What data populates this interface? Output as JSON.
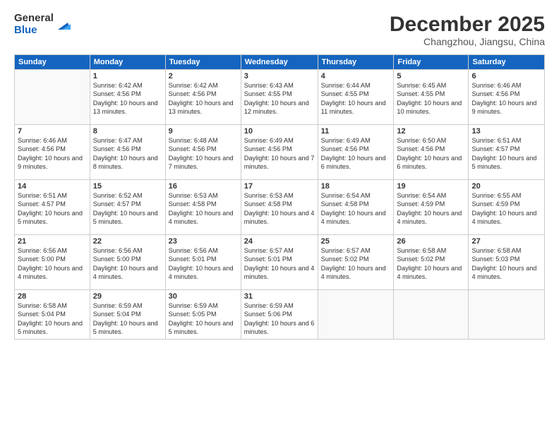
{
  "logo": {
    "general": "General",
    "blue": "Blue"
  },
  "title": "December 2025",
  "location": "Changzhou, Jiangsu, China",
  "weekdays": [
    "Sunday",
    "Monday",
    "Tuesday",
    "Wednesday",
    "Thursday",
    "Friday",
    "Saturday"
  ],
  "weeks": [
    [
      {
        "day": "",
        "info": ""
      },
      {
        "day": "1",
        "info": "Sunrise: 6:42 AM\nSunset: 4:56 PM\nDaylight: 10 hours\nand 13 minutes."
      },
      {
        "day": "2",
        "info": "Sunrise: 6:42 AM\nSunset: 4:56 PM\nDaylight: 10 hours\nand 13 minutes."
      },
      {
        "day": "3",
        "info": "Sunrise: 6:43 AM\nSunset: 4:55 PM\nDaylight: 10 hours\nand 12 minutes."
      },
      {
        "day": "4",
        "info": "Sunrise: 6:44 AM\nSunset: 4:55 PM\nDaylight: 10 hours\nand 11 minutes."
      },
      {
        "day": "5",
        "info": "Sunrise: 6:45 AM\nSunset: 4:55 PM\nDaylight: 10 hours\nand 10 minutes."
      },
      {
        "day": "6",
        "info": "Sunrise: 6:46 AM\nSunset: 4:56 PM\nDaylight: 10 hours\nand 9 minutes."
      }
    ],
    [
      {
        "day": "7",
        "info": "Sunrise: 6:46 AM\nSunset: 4:56 PM\nDaylight: 10 hours\nand 9 minutes."
      },
      {
        "day": "8",
        "info": "Sunrise: 6:47 AM\nSunset: 4:56 PM\nDaylight: 10 hours\nand 8 minutes."
      },
      {
        "day": "9",
        "info": "Sunrise: 6:48 AM\nSunset: 4:56 PM\nDaylight: 10 hours\nand 7 minutes."
      },
      {
        "day": "10",
        "info": "Sunrise: 6:49 AM\nSunset: 4:56 PM\nDaylight: 10 hours\nand 7 minutes."
      },
      {
        "day": "11",
        "info": "Sunrise: 6:49 AM\nSunset: 4:56 PM\nDaylight: 10 hours\nand 6 minutes."
      },
      {
        "day": "12",
        "info": "Sunrise: 6:50 AM\nSunset: 4:56 PM\nDaylight: 10 hours\nand 6 minutes."
      },
      {
        "day": "13",
        "info": "Sunrise: 6:51 AM\nSunset: 4:57 PM\nDaylight: 10 hours\nand 5 minutes."
      }
    ],
    [
      {
        "day": "14",
        "info": "Sunrise: 6:51 AM\nSunset: 4:57 PM\nDaylight: 10 hours\nand 5 minutes."
      },
      {
        "day": "15",
        "info": "Sunrise: 6:52 AM\nSunset: 4:57 PM\nDaylight: 10 hours\nand 5 minutes."
      },
      {
        "day": "16",
        "info": "Sunrise: 6:53 AM\nSunset: 4:58 PM\nDaylight: 10 hours\nand 4 minutes."
      },
      {
        "day": "17",
        "info": "Sunrise: 6:53 AM\nSunset: 4:58 PM\nDaylight: 10 hours\nand 4 minutes."
      },
      {
        "day": "18",
        "info": "Sunrise: 6:54 AM\nSunset: 4:58 PM\nDaylight: 10 hours\nand 4 minutes."
      },
      {
        "day": "19",
        "info": "Sunrise: 6:54 AM\nSunset: 4:59 PM\nDaylight: 10 hours\nand 4 minutes."
      },
      {
        "day": "20",
        "info": "Sunrise: 6:55 AM\nSunset: 4:59 PM\nDaylight: 10 hours\nand 4 minutes."
      }
    ],
    [
      {
        "day": "21",
        "info": "Sunrise: 6:56 AM\nSunset: 5:00 PM\nDaylight: 10 hours\nand 4 minutes."
      },
      {
        "day": "22",
        "info": "Sunrise: 6:56 AM\nSunset: 5:00 PM\nDaylight: 10 hours\nand 4 minutes."
      },
      {
        "day": "23",
        "info": "Sunrise: 6:56 AM\nSunset: 5:01 PM\nDaylight: 10 hours\nand 4 minutes."
      },
      {
        "day": "24",
        "info": "Sunrise: 6:57 AM\nSunset: 5:01 PM\nDaylight: 10 hours\nand 4 minutes."
      },
      {
        "day": "25",
        "info": "Sunrise: 6:57 AM\nSunset: 5:02 PM\nDaylight: 10 hours\nand 4 minutes."
      },
      {
        "day": "26",
        "info": "Sunrise: 6:58 AM\nSunset: 5:02 PM\nDaylight: 10 hours\nand 4 minutes."
      },
      {
        "day": "27",
        "info": "Sunrise: 6:58 AM\nSunset: 5:03 PM\nDaylight: 10 hours\nand 4 minutes."
      }
    ],
    [
      {
        "day": "28",
        "info": "Sunrise: 6:58 AM\nSunset: 5:04 PM\nDaylight: 10 hours\nand 5 minutes."
      },
      {
        "day": "29",
        "info": "Sunrise: 6:59 AM\nSunset: 5:04 PM\nDaylight: 10 hours\nand 5 minutes."
      },
      {
        "day": "30",
        "info": "Sunrise: 6:59 AM\nSunset: 5:05 PM\nDaylight: 10 hours\nand 5 minutes."
      },
      {
        "day": "31",
        "info": "Sunrise: 6:59 AM\nSunset: 5:06 PM\nDaylight: 10 hours\nand 6 minutes."
      },
      {
        "day": "",
        "info": ""
      },
      {
        "day": "",
        "info": ""
      },
      {
        "day": "",
        "info": ""
      }
    ]
  ]
}
